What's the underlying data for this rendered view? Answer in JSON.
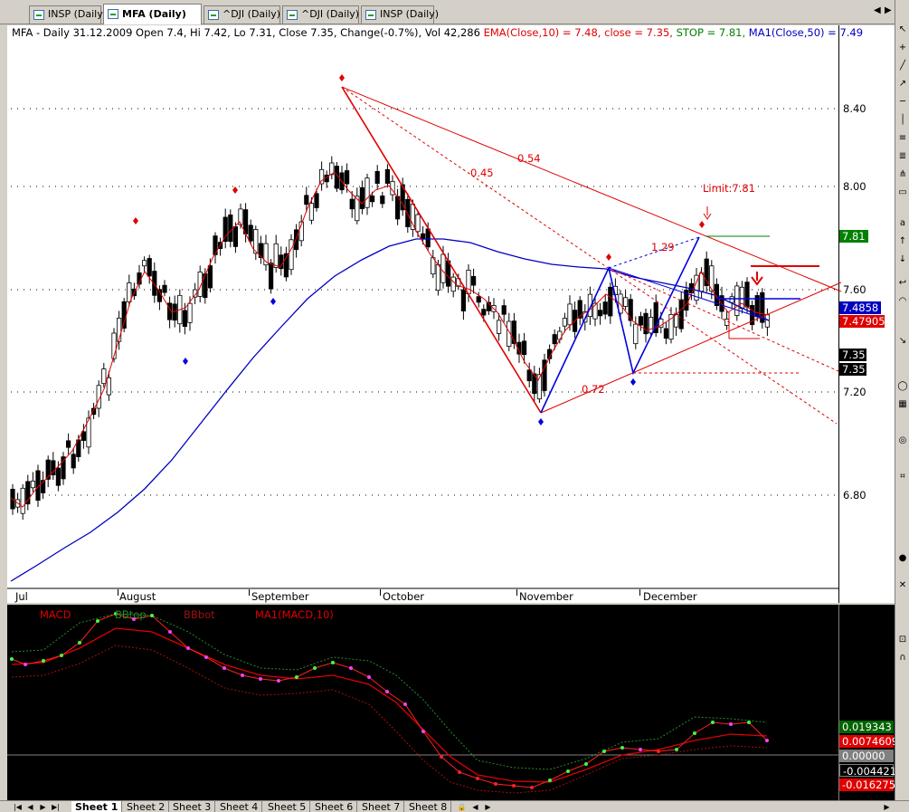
{
  "tabs": [
    {
      "label": "INSP (Daily)",
      "active": false
    },
    {
      "label": "MFA (Daily)",
      "active": true
    },
    {
      "label": "^DJI (Daily)",
      "active": false
    },
    {
      "label": "^DJI (Daily)",
      "active": false
    },
    {
      "label": "INSP (Daily)",
      "active": false
    }
  ],
  "info": {
    "main": "MFA - Daily 31.12.2009 Open 7.4, Hi 7.42, Lo 7.31, Close 7.35, Change(-0.7%), Vol 42,286",
    "ema": "EMA(Close,10) = 7.48, close = 7.35,",
    "stop": "STOP = 7.81,",
    "ma": "MA1(Close,50) = 7.49"
  },
  "price_axis": {
    "ticks": [
      "8.40",
      "8.00",
      "7.60",
      "7.20",
      "6.80"
    ],
    "boxes": {
      "stop": {
        "text": "7.81",
        "color": "#008000"
      },
      "ma50": {
        "text": "7.4858",
        "color": "#0000c0"
      },
      "ema10": {
        "text": "7.47905",
        "color": "#e00000"
      },
      "close1": {
        "text": "7.35",
        "color": "#000000"
      },
      "close2": {
        "text": "7.35",
        "color": "#000000"
      }
    }
  },
  "time_axis": [
    "Jul",
    "August",
    "September",
    "October",
    "November",
    "December"
  ],
  "annotations": {
    "limit": "Limit:7.81",
    "fib_054": "0.54",
    "fib_045": "0.45",
    "fib_129": "1.29",
    "fib_072": "0.72"
  },
  "macd": {
    "legend": [
      {
        "label": "MACD",
        "color": "#e00000"
      },
      {
        "label": "BBtop",
        "color": "#2a8a2a"
      },
      {
        "label": "BBbot",
        "color": "#a01010"
      },
      {
        "label": "MA1(MACD,10)",
        "color": "#e00000"
      }
    ],
    "boxes": [
      {
        "text": "0.019343",
        "color": "#006400"
      },
      {
        "text": "0.0074609",
        "color": "#e00000"
      },
      {
        "text": "0.00000",
        "color": "#808080"
      },
      {
        "text": "-0.004421",
        "color": "#000000"
      },
      {
        "text": "-0.016275",
        "color": "#e00000"
      }
    ]
  },
  "sheets": [
    "Sheet 1",
    "Sheet 2",
    "Sheet 3",
    "Sheet 4",
    "Sheet 5",
    "Sheet 6",
    "Sheet 7",
    "Sheet 8"
  ],
  "colors": {
    "ema": "#e00000",
    "ma50": "#0000c0",
    "drawing_red": "#e00000",
    "drawing_blue": "#0000e0",
    "stop_line": "#008000"
  }
}
